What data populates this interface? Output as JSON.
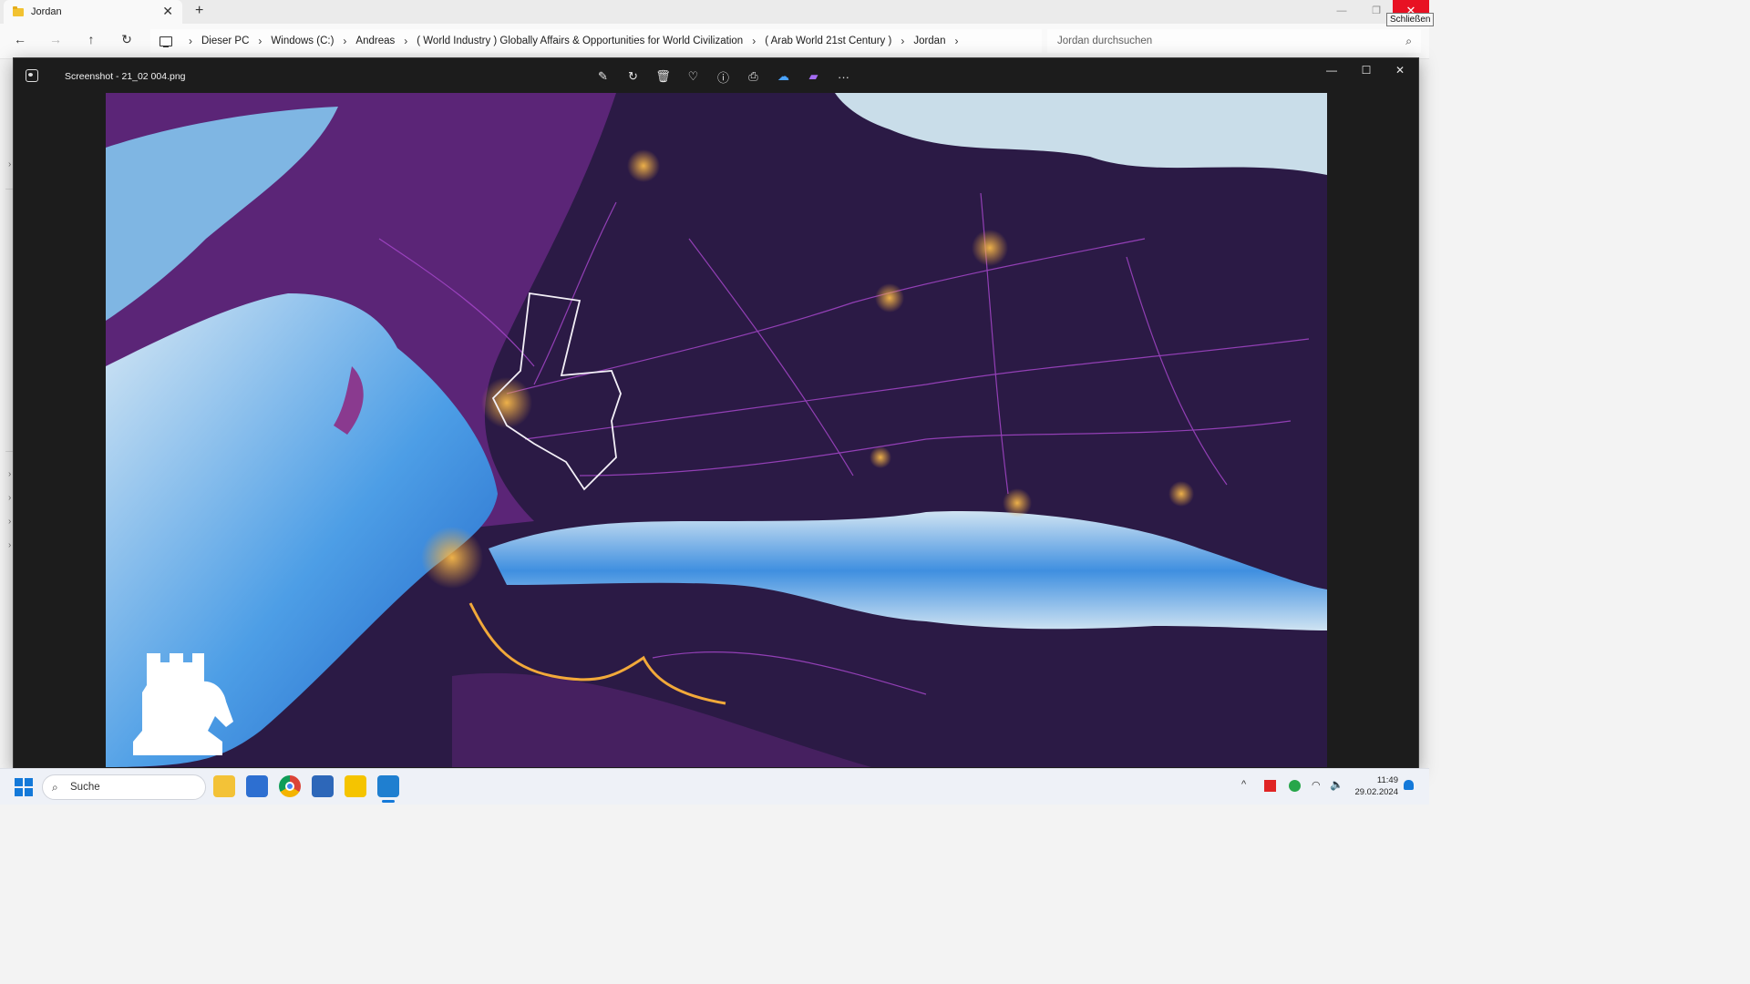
{
  "explorer": {
    "tab_title": "Jordan",
    "tab_close": "✕",
    "new_tab": "+",
    "window_controls": {
      "minimize": "—",
      "maximize": "❐",
      "close": "✕"
    },
    "tooltip": "Schließen",
    "nav": {
      "back": "←",
      "forward": "→",
      "up": "↑",
      "refresh": "↻"
    },
    "breadcrumbs": [
      "Dieser PC",
      "Windows (C:)",
      "Andreas",
      "( World Industry ) Globally Affairs & Opportunities for World Civilization",
      "( Arab World 21st Century )",
      "Jordan"
    ],
    "crumb_separator": "›",
    "search_placeholder": "Jordan durchsuchen",
    "search_icon": "⌕"
  },
  "photos": {
    "filename": "Screenshot - 21_02 004.png",
    "tools": [
      {
        "name": "edit-icon",
        "glyph": "✎"
      },
      {
        "name": "rotate-icon",
        "glyph": "↻"
      },
      {
        "name": "delete-icon",
        "glyph": "🗑"
      },
      {
        "name": "favorite-icon",
        "glyph": "♡"
      },
      {
        "name": "info-icon",
        "glyph": "ⓘ"
      },
      {
        "name": "print-icon",
        "glyph": "⎙"
      },
      {
        "name": "onedrive-icon",
        "glyph": "☁"
      },
      {
        "name": "clipchamp-icon",
        "glyph": "▰"
      },
      {
        "name": "more-icon",
        "glyph": "···"
      }
    ],
    "window_controls": {
      "minimize": "—",
      "maximize": "☐",
      "close": "✕"
    },
    "image_colors": {
      "land": "#2b1a45",
      "roads": "#9b3bc2",
      "cities": "#f2a93a",
      "sea_light": "#cfe3f2",
      "sea_deep": "#1f6ad0"
    }
  },
  "taskbar": {
    "search_label": "Suche",
    "search_icon": "⌕",
    "tray_chevron": "^",
    "wifi_icon": "◠",
    "volume_icon": "🔈",
    "time": "11:49",
    "date": "29.02.2024"
  }
}
